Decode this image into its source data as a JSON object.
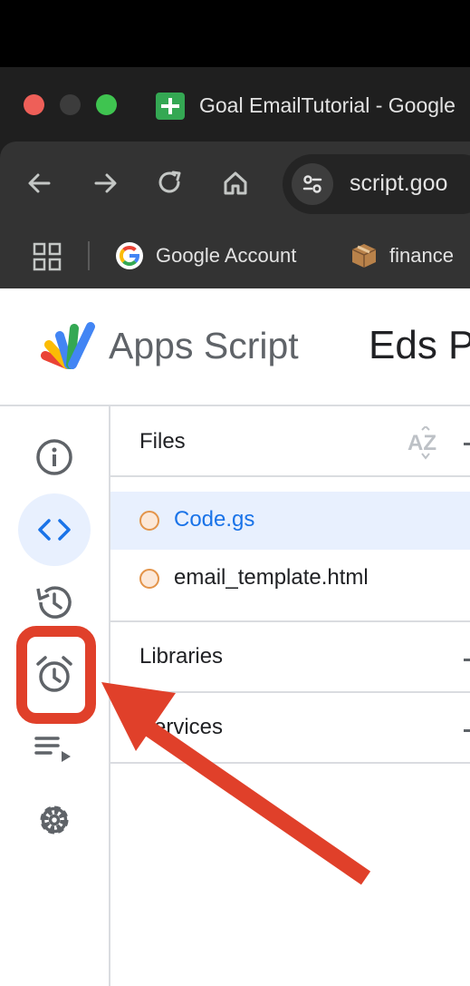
{
  "browser": {
    "tab_title": "Goal EmailTutorial - Google",
    "url": "script.goo",
    "bookmarks": [
      {
        "label": "Google Account",
        "icon": "google-logo-icon"
      },
      {
        "label": "finance",
        "icon": "package-box-icon"
      }
    ]
  },
  "app": {
    "name": "Apps Script",
    "project_title": "Eds P"
  },
  "sidebar": {
    "items": [
      {
        "name": "overview",
        "icon": "info-icon",
        "active": false
      },
      {
        "name": "editor",
        "icon": "code-brackets-icon",
        "active": true
      },
      {
        "name": "executions",
        "icon": "history-icon",
        "active": false
      },
      {
        "name": "triggers",
        "icon": "alarm-clock-icon",
        "active": false,
        "highlighted": true
      },
      {
        "name": "executions-list",
        "icon": "playlist-icon",
        "active": false
      },
      {
        "name": "project-settings",
        "icon": "gear-icon",
        "active": false
      }
    ]
  },
  "files_panel": {
    "header": "Files",
    "sort_label": "AZ",
    "files": [
      {
        "name": "Code.gs",
        "selected": true
      },
      {
        "name": "email_template.html",
        "selected": false
      }
    ],
    "sections": [
      {
        "label": "Libraries"
      },
      {
        "label": "Services"
      }
    ]
  },
  "colors": {
    "accent_blue": "#1a73e8",
    "selected_bg": "#e8f0fe",
    "annotation_red": "#e0402a",
    "file_dot_orange": "#e3944a"
  }
}
